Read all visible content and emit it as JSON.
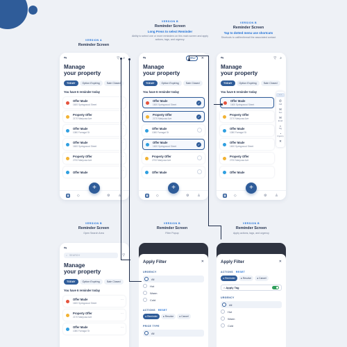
{
  "colors": {
    "primary": "#2f5c99",
    "accent": "#1a6dd6",
    "background": "#eef1f6",
    "hot": "#e5533d",
    "warm": "#f2b233",
    "cold": "#2f9fe0",
    "toggle_on": "#2f9e5a"
  },
  "captions": [
    {
      "version": "VERSION A",
      "title": "Reminder Screen",
      "sub": "",
      "desc": ""
    },
    {
      "version": "VERSION B",
      "title": "Reminder Screen",
      "sub": "Long Press to select Reminder",
      "desc": "Ability to select one or more reminders on this main screen and apply actions, tags, and urgency."
    },
    {
      "version": "VERSION B",
      "title": "Reminder Screen",
      "sub": "Tap to dotted menu use shortcuts",
      "desc": "Shortcuts to call/text/email the associated contact"
    },
    {
      "version": "VERSION B",
      "title": "Reminder Screen",
      "sub": "",
      "desc": "Open Search Area"
    },
    {
      "version": "VERSION B",
      "title": "Reminder Screen",
      "sub": "",
      "desc": "Filter Popup"
    },
    {
      "version": "VERSION B",
      "title": "Reminder Screen",
      "sub": "",
      "desc": "Apply actions, tags, and urgency"
    }
  ],
  "screen": {
    "title_line1": "Manage",
    "title_line2": "your property",
    "tabs": [
      "TODAY",
      "Option Expiring",
      "Sale Closed"
    ],
    "count": "You have 6 reminder today",
    "apply_label": "APPLY",
    "search_placeholder": "SEARCH",
    "fab": "+"
  },
  "icons": {
    "back": "⇆",
    "filter": "▽",
    "search": "⌕",
    "close": "✕",
    "more": "⋯",
    "check": "✓"
  },
  "items": [
    {
      "title": "Offer Made",
      "sub": "1600 Springwood Street",
      "urgency": "hot"
    },
    {
      "title": "Property Offer",
      "sub": "2170 Mariposa Ave",
      "urgency": "warm"
    },
    {
      "title": "Offer Made",
      "sub": "1080 Farragut St",
      "urgency": "cold"
    },
    {
      "title": "Offer Made",
      "sub": "1600 Springwood Street",
      "urgency": "cold"
    },
    {
      "title": "Property Offer",
      "sub": "2700 Mariposa Ave",
      "urgency": "warm"
    },
    {
      "title": "Offer Made",
      "sub": "1600 Springwood Street",
      "urgency": "cold"
    }
  ],
  "shortcuts": [
    {
      "icon": "⋯",
      "label": ""
    },
    {
      "icon": "✆",
      "label": "Call"
    },
    {
      "icon": "✉",
      "label": "Text"
    },
    {
      "icon": "✉",
      "label": "Email"
    },
    {
      "icon": "⌂",
      "label": "Tag"
    },
    {
      "icon": "◔",
      "label": "Urgency"
    },
    {
      "icon": "✕",
      "label": ""
    }
  ],
  "filter": {
    "title": "Apply Filter",
    "urgency_label": "URGENCY",
    "urgency_options": [
      "All",
      "Hot",
      "Warm",
      "Cold"
    ],
    "actions_label": "ACTIONS",
    "reset_label": "RESET",
    "actions": [
      "Reminder",
      "Resolve",
      "Cancel"
    ],
    "price_label": "PRICE TYPE",
    "price_options": [
      "All"
    ],
    "apply_tag": "Apply Tag"
  }
}
